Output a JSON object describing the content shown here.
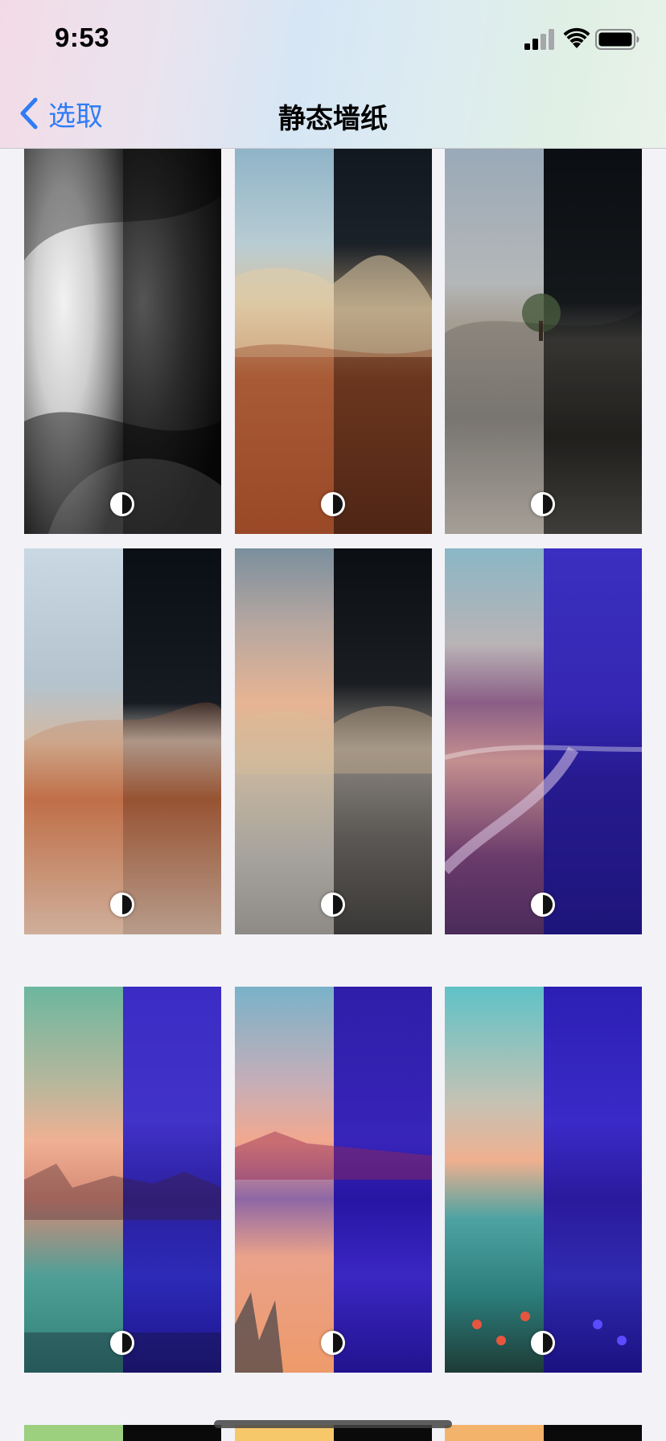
{
  "status_bar": {
    "time": "9:53",
    "icons": [
      "signal-icon",
      "wifi-icon",
      "battery-icon"
    ]
  },
  "nav": {
    "back_label": "选取",
    "title": "静态墙纸"
  },
  "colors": {
    "accent": "#2f7cf6",
    "background": "#f2f2f7"
  },
  "wallpapers": [
    {
      "name": "abstract-gray"
    },
    {
      "name": "desert-rock-evening"
    },
    {
      "name": "desert-tree"
    },
    {
      "name": "desert-rock-sky"
    },
    {
      "name": "desert-rock-sunset"
    },
    {
      "name": "coastal-road"
    },
    {
      "name": "lake-canyon"
    },
    {
      "name": "desert-dunes"
    },
    {
      "name": "coast-flowers"
    },
    {
      "name": "partial-green"
    },
    {
      "name": "partial-yellow"
    },
    {
      "name": "partial-orange"
    }
  ]
}
